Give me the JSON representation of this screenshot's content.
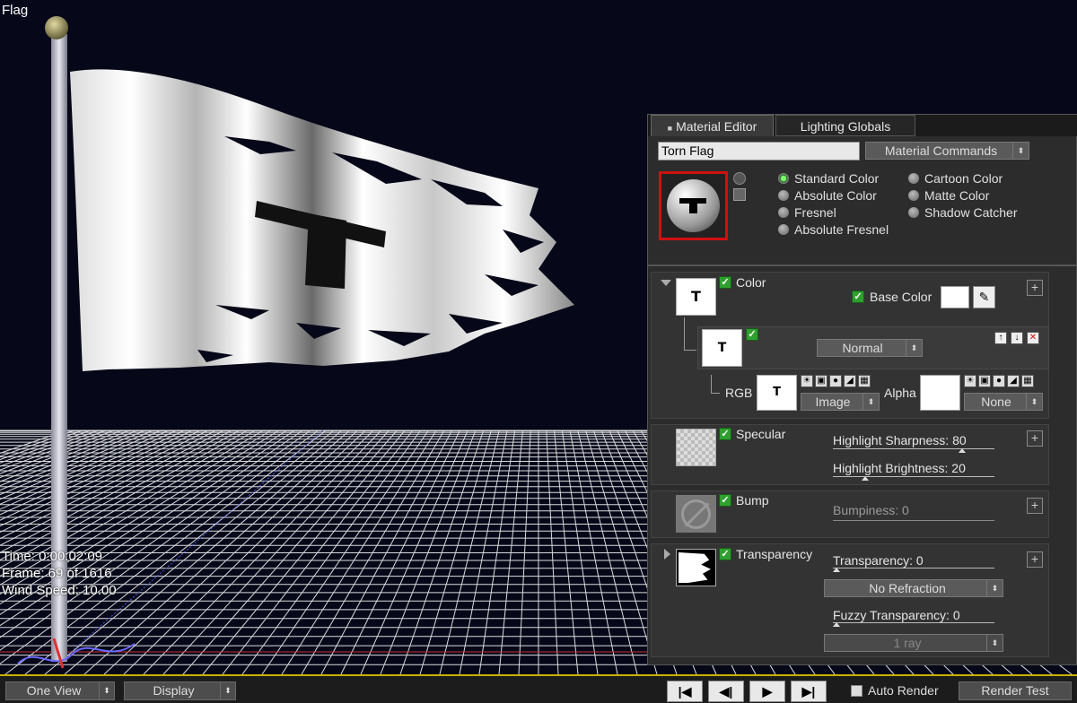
{
  "viewport": {
    "title": "Flag",
    "hud": {
      "time": "Time: 0:00:02:09",
      "frame": "Frame: 69 of 1616",
      "wind": "Wind Speed: 10.00"
    },
    "flag_letter": "T"
  },
  "editor": {
    "tabs": [
      "Material Editor",
      "Lighting Globals"
    ],
    "material_name": "Torn Flag",
    "material_commands": "Material Commands",
    "radios": [
      {
        "label": "Standard Color",
        "selected": true
      },
      {
        "label": "Absolute Color",
        "selected": false
      },
      {
        "label": "Fresnel",
        "selected": false
      },
      {
        "label": "Absolute Fresnel",
        "selected": false
      },
      {
        "label": "Cartoon Color",
        "selected": false
      },
      {
        "label": "Matte Color",
        "selected": false
      },
      {
        "label": "Shadow Catcher",
        "selected": false
      }
    ],
    "color": {
      "title": "Color",
      "base_color": "Base Color",
      "blend_mode": "Normal",
      "rgb": "RGB",
      "alpha": "Alpha",
      "image": "Image",
      "none": "None",
      "thumb": "T"
    },
    "specular": {
      "title": "Specular",
      "sharpness": "Highlight Sharpness: 80",
      "sharpness_value": 80,
      "brightness": "Highlight Brightness: 20",
      "brightness_value": 20
    },
    "bump": {
      "title": "Bump",
      "bumpiness": "Bumpiness: 0"
    },
    "transparency": {
      "title": "Transparency",
      "transparency": "Transparency: 0",
      "refraction": "No Refraction",
      "fuzzy": "Fuzzy Transparency: 0",
      "ray": "1 ray"
    }
  },
  "bottombar": {
    "view": "One View",
    "display": "Display",
    "auto_render": "Auto Render",
    "render_test": "Render Test"
  },
  "colors": {
    "background": "#060819",
    "accent_green": "#2fa02f",
    "selection_red": "#d01010",
    "timeline_yellow": "#c9b000"
  }
}
